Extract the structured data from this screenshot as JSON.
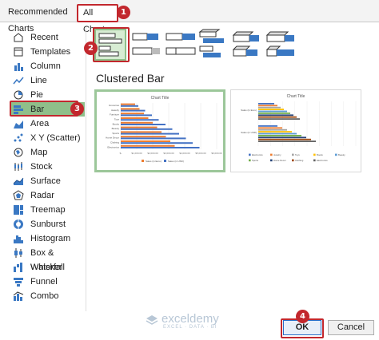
{
  "tabs": {
    "recommended": "Recommended Charts",
    "all": "All Charts"
  },
  "badges": {
    "one": "1",
    "two": "2",
    "three": "3",
    "four": "4"
  },
  "sidebar": {
    "items": [
      {
        "label": "Recent",
        "icon": "recent-icon"
      },
      {
        "label": "Templates",
        "icon": "templates-icon"
      },
      {
        "label": "Column",
        "icon": "column-chart-icon"
      },
      {
        "label": "Line",
        "icon": "line-chart-icon"
      },
      {
        "label": "Pie",
        "icon": "pie-chart-icon"
      },
      {
        "label": "Bar",
        "icon": "bar-chart-icon"
      },
      {
        "label": "Area",
        "icon": "area-chart-icon"
      },
      {
        "label": "X Y (Scatter)",
        "icon": "scatter-chart-icon"
      },
      {
        "label": "Map",
        "icon": "map-chart-icon"
      },
      {
        "label": "Stock",
        "icon": "stock-chart-icon"
      },
      {
        "label": "Surface",
        "icon": "surface-chart-icon"
      },
      {
        "label": "Radar",
        "icon": "radar-chart-icon"
      },
      {
        "label": "Treemap",
        "icon": "treemap-chart-icon"
      },
      {
        "label": "Sunburst",
        "icon": "sunburst-chart-icon"
      },
      {
        "label": "Histogram",
        "icon": "histogram-chart-icon"
      },
      {
        "label": "Box & Whisker",
        "icon": "box-whisker-chart-icon"
      },
      {
        "label": "Waterfall",
        "icon": "waterfall-chart-icon"
      },
      {
        "label": "Funnel",
        "icon": "funnel-chart-icon"
      },
      {
        "label": "Combo",
        "icon": "combo-chart-icon"
      }
    ],
    "selected": "Bar"
  },
  "main": {
    "section_title": "Clustered Bar",
    "preview1": {
      "title": "Chart Title",
      "categories": [
        "Groceries",
        "Jewelry",
        "Furniture",
        "Toys",
        "Books",
        "Beauty",
        "Sports",
        "Home Decor",
        "Clothing",
        "Electronics"
      ],
      "ticks": [
        "$-",
        "$1,000.00",
        "$2,000.00",
        "$3,000.00",
        "$4,000.00",
        "$5,000.00",
        "$6,000.00"
      ],
      "legend": [
        "Sales (in Euro)",
        "Sales (in USD)"
      ]
    },
    "preview2": {
      "title": "Chart Title",
      "groups": [
        "Sales (in Euro)",
        "Sales (in USD)"
      ],
      "legend": [
        "Electronics",
        "Jewelry",
        "Toys",
        "Books",
        "Beauty",
        "Sports",
        "Home Decor",
        "Clothing",
        "Electronics"
      ]
    }
  },
  "watermark": {
    "name": "exceldemy",
    "tagline": "EXCEL · DATA · BI"
  },
  "buttons": {
    "ok": "OK",
    "cancel": "Cancel"
  },
  "colors": {
    "highlight": "#c2272d",
    "selected_bg": "#8fbf8a",
    "bar_orange": "#ed7d31",
    "bar_blue": "#4472c4"
  }
}
